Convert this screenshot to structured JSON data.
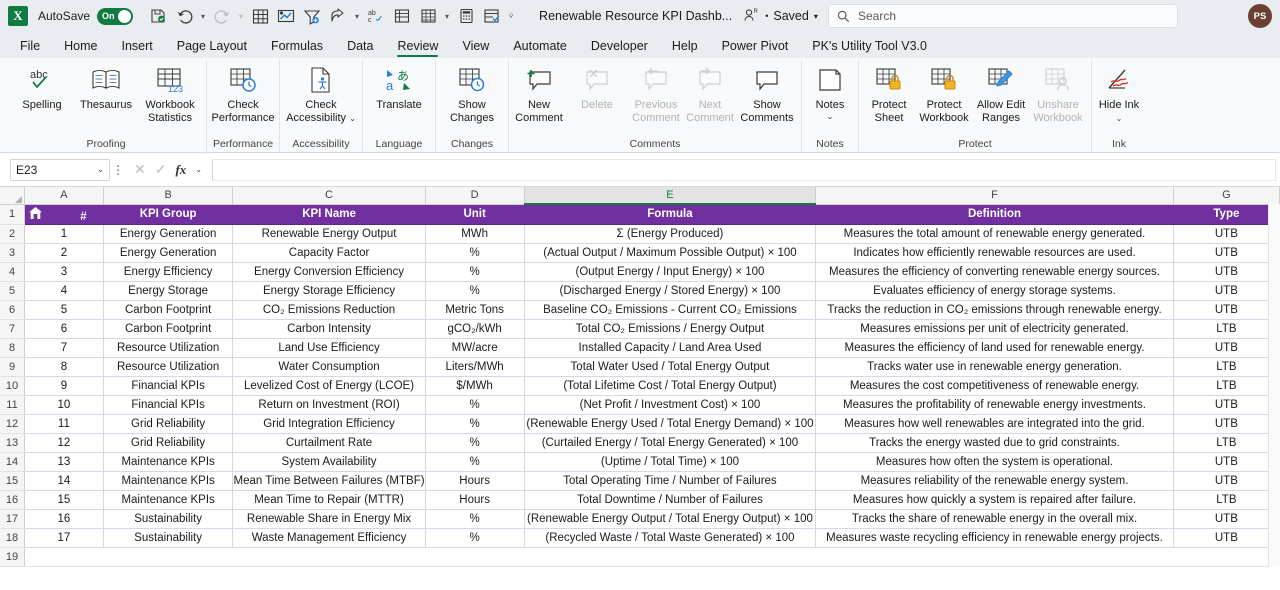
{
  "titlebar": {
    "autosave_label": "AutoSave",
    "autosave_state": "On",
    "document_title": "Renewable Resource KPI Dashb...",
    "saved_status": "Saved",
    "search_placeholder": "Search",
    "avatar_initials": "PS"
  },
  "tabs": [
    {
      "label": "File",
      "active": false
    },
    {
      "label": "Home",
      "active": false
    },
    {
      "label": "Insert",
      "active": false
    },
    {
      "label": "Page Layout",
      "active": false
    },
    {
      "label": "Formulas",
      "active": false
    },
    {
      "label": "Data",
      "active": false
    },
    {
      "label": "Review",
      "active": true
    },
    {
      "label": "View",
      "active": false
    },
    {
      "label": "Automate",
      "active": false
    },
    {
      "label": "Developer",
      "active": false
    },
    {
      "label": "Help",
      "active": false
    },
    {
      "label": "Power Pivot",
      "active": false
    },
    {
      "label": "PK's Utility Tool V3.0",
      "active": false
    }
  ],
  "ribbon": {
    "groups": [
      {
        "name": "Proofing",
        "items": [
          {
            "label": "Spelling",
            "icon": "spelling-icon",
            "disabled": false
          },
          {
            "label": "Thesaurus",
            "icon": "thesaurus-icon",
            "disabled": false
          },
          {
            "label": "Workbook Statistics",
            "icon": "workbook-statistics-icon",
            "disabled": false
          }
        ]
      },
      {
        "name": "Performance",
        "items": [
          {
            "label": "Check Performance",
            "icon": "check-performance-icon",
            "disabled": false
          }
        ]
      },
      {
        "name": "Accessibility",
        "items": [
          {
            "label": "Check Accessibility",
            "icon": "check-accessibility-icon",
            "disabled": false,
            "caret": true
          }
        ]
      },
      {
        "name": "Language",
        "items": [
          {
            "label": "Translate",
            "icon": "translate-icon",
            "disabled": false
          }
        ]
      },
      {
        "name": "Changes",
        "items": [
          {
            "label": "Show Changes",
            "icon": "show-changes-icon",
            "disabled": false
          }
        ]
      },
      {
        "name": "Comments",
        "items": [
          {
            "label": "New Comment",
            "icon": "new-comment-icon",
            "disabled": false
          },
          {
            "label": "Delete",
            "icon": "delete-comment-icon",
            "disabled": true
          },
          {
            "label": "Previous Comment",
            "icon": "previous-comment-icon",
            "disabled": true
          },
          {
            "label": "Next Comment",
            "icon": "next-comment-icon",
            "disabled": true
          },
          {
            "label": "Show Comments",
            "icon": "show-comments-icon",
            "disabled": false
          }
        ]
      },
      {
        "name": "Notes",
        "items": [
          {
            "label": "Notes",
            "icon": "notes-icon",
            "disabled": false,
            "caret": true
          }
        ]
      },
      {
        "name": "Protect",
        "items": [
          {
            "label": "Protect Sheet",
            "icon": "protect-sheet-icon",
            "disabled": false
          },
          {
            "label": "Protect Workbook",
            "icon": "protect-workbook-icon",
            "disabled": false
          },
          {
            "label": "Allow Edit Ranges",
            "icon": "allow-edit-ranges-icon",
            "disabled": false
          },
          {
            "label": "Unshare Workbook",
            "icon": "unshare-workbook-icon",
            "disabled": true
          }
        ]
      },
      {
        "name": "Ink",
        "items": [
          {
            "label": "Hide Ink",
            "icon": "hide-ink-icon",
            "disabled": false,
            "caret": true
          }
        ]
      }
    ]
  },
  "formula_bar": {
    "name_box_value": "E23",
    "formula_value": ""
  },
  "sheet": {
    "column_letters": [
      "A",
      "B",
      "C",
      "D",
      "E",
      "F",
      "G"
    ],
    "selected_column": "E",
    "row_numbers": [
      "1",
      "2",
      "3",
      "4",
      "5",
      "6",
      "7",
      "8",
      "9",
      "10",
      "11",
      "12",
      "13",
      "14",
      "15",
      "16",
      "17",
      "18",
      "19"
    ],
    "header_row": {
      "a": "#",
      "b": "KPI Group",
      "c": "KPI Name",
      "d": "Unit",
      "e": "Formula",
      "f": "Definition",
      "g": "Type",
      "home_icon": "home-icon"
    },
    "rows": [
      {
        "num": "1",
        "group": "Energy Generation",
        "kpi": "Renewable Energy Output",
        "unit": "MWh",
        "formula": "Σ (Energy Produced)",
        "definition": "Measures the total amount of renewable energy generated.",
        "type": "UTB"
      },
      {
        "num": "2",
        "group": "Energy Generation",
        "kpi": "Capacity Factor",
        "unit": "%",
        "formula": "(Actual Output / Maximum Possible Output) × 100",
        "definition": "Indicates how efficiently renewable resources are used.",
        "type": "UTB"
      },
      {
        "num": "3",
        "group": "Energy Efficiency",
        "kpi": "Energy Conversion Efficiency",
        "unit": "%",
        "formula": "(Output Energy / Input Energy) × 100",
        "definition": "Measures the efficiency of converting renewable energy sources.",
        "type": "UTB"
      },
      {
        "num": "4",
        "group": "Energy Storage",
        "kpi": "Energy Storage Efficiency",
        "unit": "%",
        "formula": "(Discharged Energy / Stored Energy) × 100",
        "definition": "Evaluates efficiency of energy storage systems.",
        "type": "UTB"
      },
      {
        "num": "5",
        "group": "Carbon Footprint",
        "kpi": "CO₂ Emissions Reduction",
        "unit": "Metric Tons",
        "formula": "Baseline CO₂ Emissions - Current CO₂ Emissions",
        "definition": "Tracks the reduction in CO₂ emissions through renewable energy.",
        "type": "UTB"
      },
      {
        "num": "6",
        "group": "Carbon Footprint",
        "kpi": "Carbon Intensity",
        "unit": "gCO₂/kWh",
        "formula": "Total CO₂ Emissions / Energy Output",
        "definition": "Measures emissions per unit of electricity generated.",
        "type": "LTB"
      },
      {
        "num": "7",
        "group": "Resource Utilization",
        "kpi": "Land Use Efficiency",
        "unit": "MW/acre",
        "formula": "Installed Capacity / Land Area Used",
        "definition": "Measures the efficiency of land used for renewable energy.",
        "type": "UTB"
      },
      {
        "num": "8",
        "group": "Resource Utilization",
        "kpi": "Water Consumption",
        "unit": "Liters/MWh",
        "formula": "Total Water Used / Total Energy Output",
        "definition": "Tracks water use in renewable energy generation.",
        "type": "LTB"
      },
      {
        "num": "9",
        "group": "Financial KPIs",
        "kpi": "Levelized Cost of Energy (LCOE)",
        "unit": "$/MWh",
        "formula": "(Total Lifetime Cost / Total Energy Output)",
        "definition": "Measures the cost competitiveness of renewable energy.",
        "type": "LTB"
      },
      {
        "num": "10",
        "group": "Financial KPIs",
        "kpi": "Return on Investment (ROI)",
        "unit": "%",
        "formula": "(Net Profit / Investment Cost) × 100",
        "definition": "Measures the profitability of renewable energy investments.",
        "type": "UTB"
      },
      {
        "num": "11",
        "group": "Grid Reliability",
        "kpi": "Grid Integration Efficiency",
        "unit": "%",
        "formula": "(Renewable Energy Used / Total Energy Demand) × 100",
        "definition": "Measures how well renewables are integrated into the grid.",
        "type": "UTB"
      },
      {
        "num": "12",
        "group": "Grid Reliability",
        "kpi": "Curtailment Rate",
        "unit": "%",
        "formula": "(Curtailed Energy / Total Energy Generated) × 100",
        "definition": "Tracks the energy wasted due to grid constraints.",
        "type": "LTB"
      },
      {
        "num": "13",
        "group": "Maintenance KPIs",
        "kpi": "System Availability",
        "unit": "%",
        "formula": "(Uptime / Total Time) × 100",
        "definition": "Measures how often the system is operational.",
        "type": "UTB"
      },
      {
        "num": "14",
        "group": "Maintenance KPIs",
        "kpi": "Mean Time Between Failures (MTBF)",
        "unit": "Hours",
        "formula": "Total Operating Time / Number of Failures",
        "definition": "Measures reliability of the renewable energy system.",
        "type": "UTB"
      },
      {
        "num": "15",
        "group": "Maintenance KPIs",
        "kpi": "Mean Time to Repair (MTTR)",
        "unit": "Hours",
        "formula": "Total Downtime / Number of Failures",
        "definition": "Measures how quickly a system is repaired after failure.",
        "type": "LTB"
      },
      {
        "num": "16",
        "group": "Sustainability",
        "kpi": "Renewable Share in Energy Mix",
        "unit": "%",
        "formula": "(Renewable Energy Output / Total Energy Output) × 100",
        "definition": "Tracks the share of renewable energy in the overall mix.",
        "type": "UTB"
      },
      {
        "num": "17",
        "group": "Sustainability",
        "kpi": "Waste Management Efficiency",
        "unit": "%",
        "formula": "(Recycled Waste / Total Waste Generated) × 100",
        "definition": "Measures waste recycling efficiency in renewable energy projects.",
        "type": "UTB"
      }
    ]
  },
  "colors": {
    "header_purple": "#7030A0",
    "excel_green": "#107C41",
    "avatar_brown": "#6B3F31"
  }
}
